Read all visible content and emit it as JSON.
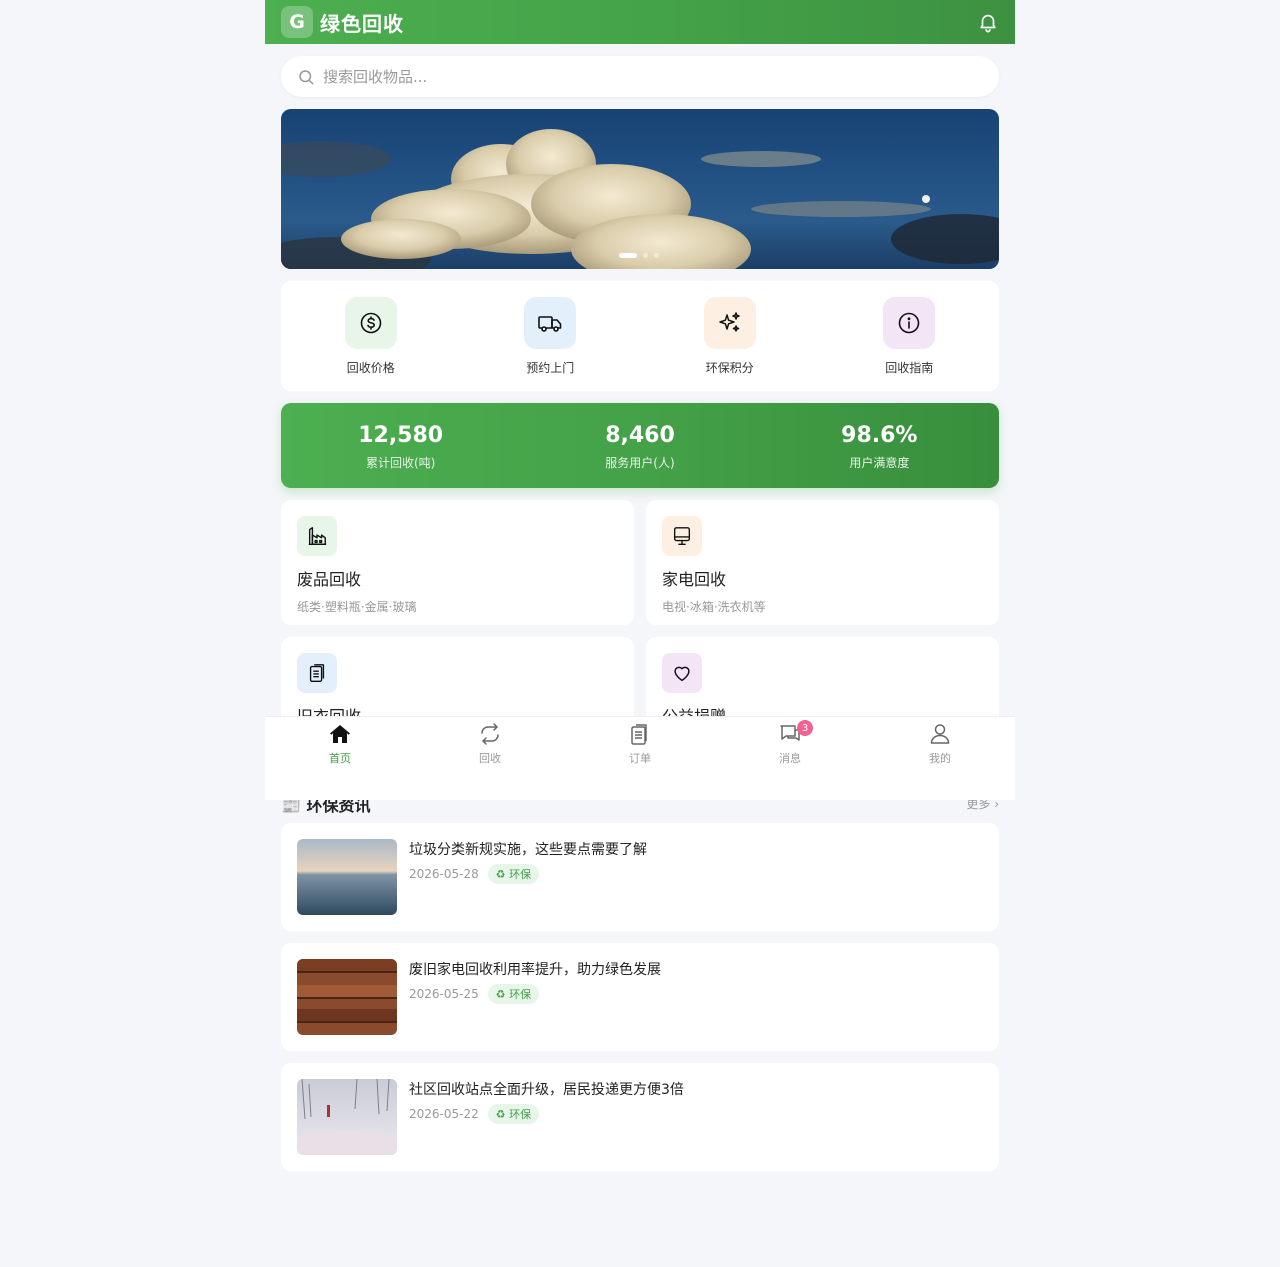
{
  "header": {
    "logo_letter": "G",
    "app_title": "绿色回收"
  },
  "search": {
    "placeholder": "搜索回收物品..."
  },
  "banner": {
    "dots": 3,
    "active_dot": 0
  },
  "quick_actions": [
    {
      "label": "回收价格",
      "icon": "dollar-circle-icon",
      "bg": "#e8f5e9"
    },
    {
      "label": "预约上门",
      "icon": "truck-icon",
      "bg": "#e3f0fb"
    },
    {
      "label": "环保积分",
      "icon": "sparkle-icon",
      "bg": "#fdf0e2"
    },
    {
      "label": "回收指南",
      "icon": "info-circle-icon",
      "bg": "#f3e5f5"
    }
  ],
  "stats": [
    {
      "value": "12,580",
      "label": "累计回收(吨)"
    },
    {
      "value": "8,460",
      "label": "服务用户(人)"
    },
    {
      "value": "98.6%",
      "label": "用户满意度"
    }
  ],
  "service_cards": [
    {
      "title": "废品回收",
      "sub": "纸类·塑料瓶·金属·玻璃",
      "icon": "factory-icon",
      "bg": "#e8f5e9"
    },
    {
      "title": "家电回收",
      "sub": "电视·冰箱·洗衣机等",
      "icon": "monitor-icon",
      "bg": "#fdf0e2"
    },
    {
      "title": "旧衣回收",
      "sub": "",
      "icon": "clipboard-icon",
      "bg": "#e3f0fb"
    },
    {
      "title": "公益捐赠",
      "sub": "",
      "icon": "heart-icon",
      "bg": "#f3e5f5"
    }
  ],
  "news_section": {
    "title": "📰 环保资讯",
    "more": "更多 ›"
  },
  "news": [
    {
      "title": "垃圾分类新规实施，这些要点需要了解",
      "date": "2026-05-28",
      "tag": "♻ 环保"
    },
    {
      "title": "废旧家电回收利用率提升，助力绿色发展",
      "date": "2026-05-25",
      "tag": "♻ 环保"
    },
    {
      "title": "社区回收站点全面升级，居民投递更方便3倍",
      "date": "2026-05-22",
      "tag": "♻ 环保"
    }
  ],
  "tabbar": [
    {
      "label": "首页",
      "icon": "home-icon",
      "active": true
    },
    {
      "label": "回收",
      "icon": "recycle-icon",
      "active": false
    },
    {
      "label": "订单",
      "icon": "orders-icon",
      "active": false
    },
    {
      "label": "消息",
      "icon": "message-icon",
      "active": false,
      "badge": "3"
    },
    {
      "label": "我的",
      "icon": "user-icon",
      "active": false
    }
  ],
  "colors": {
    "brand": "#43a047",
    "badge": "#f06292"
  }
}
